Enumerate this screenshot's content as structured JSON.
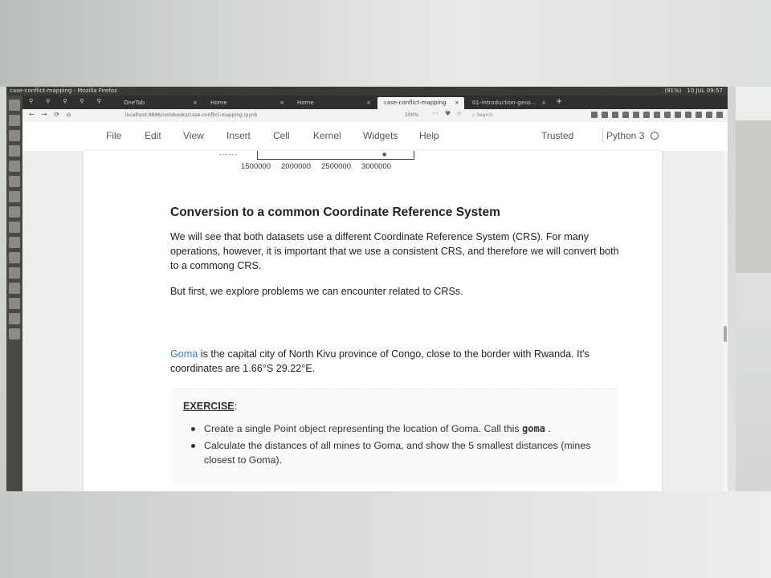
{
  "os": {
    "window_title": "case-conflict-mapping - Mozilla Firefox",
    "tray": [
      "(91%)",
      "10 JUL 09:57"
    ]
  },
  "browser": {
    "tabs": [
      {
        "label": "OneTab",
        "active": false
      },
      {
        "label": "Home",
        "active": false
      },
      {
        "label": "Home",
        "active": false
      },
      {
        "label": "case-conflict-mapping",
        "active": true
      },
      {
        "label": "01-introduction-geos...",
        "active": false
      }
    ],
    "new_tab": "+",
    "close_glyph": "×",
    "url": "localhost:8886/notebooks/case-conflict-mapping.ipynb",
    "zoom": "200%",
    "search_placeholder": "Search"
  },
  "jupyter": {
    "menu": [
      "File",
      "Edit",
      "View",
      "Insert",
      "Cell",
      "Kernel",
      "Widgets",
      "Help"
    ],
    "trusted": "Trusted",
    "kernel": "Python 3"
  },
  "plot_fragment": {
    "tick_labels": [
      "1500000",
      "2000000",
      "2500000",
      "3000000"
    ]
  },
  "notebook": {
    "heading": "Conversion to a common Coordinate Reference System",
    "para1": "We will see that both datasets use a different Coordinate Reference System (CRS). For many operations, however, it is important that we use a consistent CRS, and therefore we will convert both to a commong CRS.",
    "para2": "But first, we explore problems we can encounter related to CRSs.",
    "goma_link": "Goma",
    "para3_rest": " is the capital city of North Kivu province of Congo, close to the border with Rwanda. It's coordinates are 1.66°S 29.22°E.",
    "exercise_title": "EXERCISE",
    "exercise_colon": ":",
    "exercise_items": [
      {
        "pre": "Create a single Point object representing the location of Goma. Call this ",
        "code": "goma",
        "post": " ."
      },
      {
        "pre": "Calculate the distances of all mines to Goma, and show the 5 smallest distances (mines closest to Goma).",
        "code": "",
        "post": ""
      }
    ]
  }
}
